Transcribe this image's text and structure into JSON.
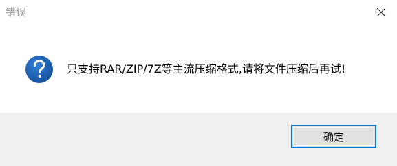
{
  "window": {
    "title": "错误"
  },
  "dialog": {
    "icon": "question-icon",
    "message": "只支持RAR/ZIP/7Z等主流压缩格式,请将文件压缩后再试!",
    "ok_label": "确定"
  },
  "colors": {
    "accent": "#0078d7",
    "icon_blue": "#1c5fb0",
    "footer_bg": "#f0f0f0",
    "button_bg": "#e1e1e1"
  }
}
